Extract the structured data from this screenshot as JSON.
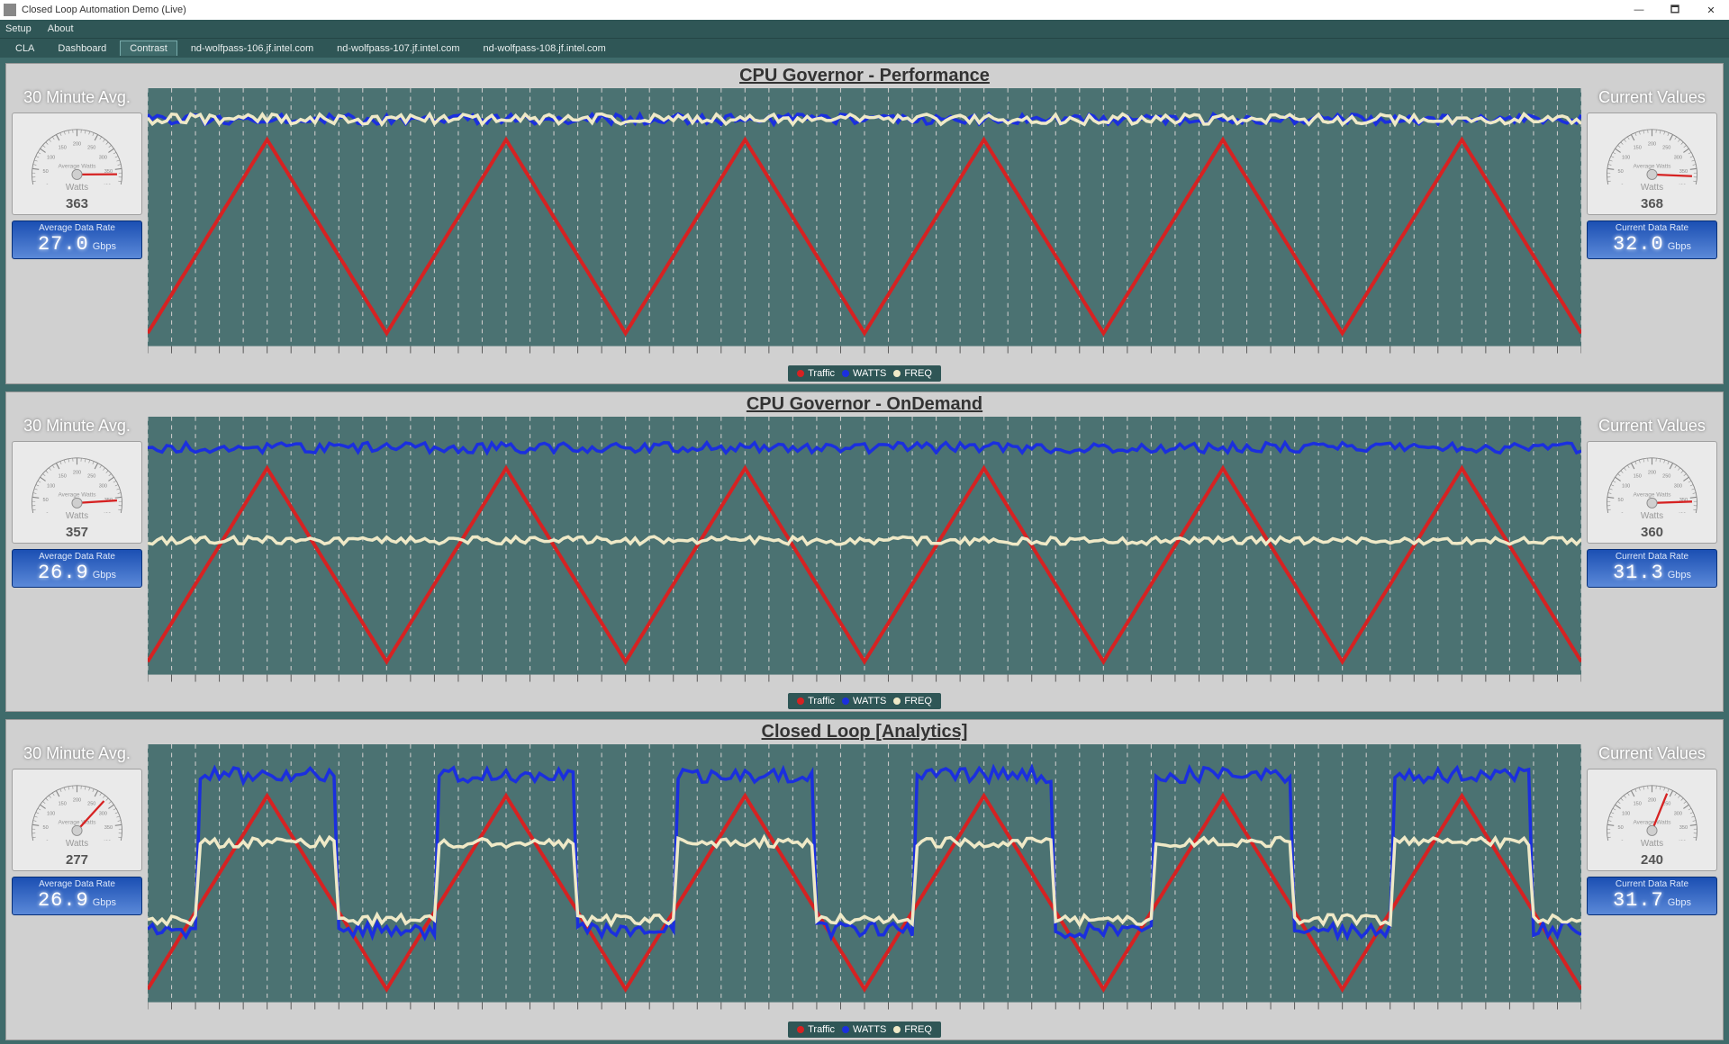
{
  "window": {
    "title": "Closed Loop Automation Demo (Live)"
  },
  "menubar": [
    "Setup",
    "About"
  ],
  "tabs": [
    "CLA",
    "Dashboard",
    "Contrast",
    "nd-wolfpass-106.jf.intel.com",
    "nd-wolfpass-107.jf.intel.com",
    "nd-wolfpass-108.jf.intel.com"
  ],
  "tabs_selected_index": 2,
  "side_headings": {
    "left": "30 Minute Avg.",
    "right": "Current Values"
  },
  "gauge": {
    "label": "Average Watts",
    "sub": "Watts",
    "ticks": [
      0,
      50,
      100,
      150,
      200,
      250,
      300,
      350,
      400
    ]
  },
  "lcd": {
    "left_label": "Average Data Rate",
    "right_label": "Current Data Rate",
    "unit": "Gbps"
  },
  "legend": [
    {
      "name": "Traffic",
      "color": "#d62222"
    },
    {
      "name": "WATTS",
      "color": "#1b2fde"
    },
    {
      "name": "FREQ",
      "color": "#efe9c7"
    }
  ],
  "colors": {
    "panel_bg": "#d0d0d0",
    "chart_bg": "#4b7272",
    "needle": "#d62222"
  },
  "panels": [
    {
      "title": "CPU Governor - Performance",
      "left": {
        "watts": 363,
        "rate": "27.0"
      },
      "right": {
        "watts": 368,
        "rate": "32.0"
      }
    },
    {
      "title": "CPU Governor - OnDemand",
      "left": {
        "watts": 357,
        "rate": "26.9"
      },
      "right": {
        "watts": 360,
        "rate": "31.3"
      }
    },
    {
      "title": "Closed Loop [Analytics]",
      "left": {
        "watts": 277,
        "rate": "26.9"
      },
      "right": {
        "watts": 240,
        "rate": "31.7"
      }
    }
  ],
  "chart_data": [
    {
      "type": "line",
      "title": "CPU Governor - Performance",
      "xlabel": "",
      "ylabel": "",
      "x_range": [
        0,
        300
      ],
      "period_seconds": 50,
      "series": [
        {
          "name": "Traffic",
          "color": "#d62222",
          "range": [
            5,
            60
          ],
          "shape": "triangle",
          "amplitude": 48,
          "baseline": 12
        },
        {
          "name": "WATTS",
          "color": "#1b2fde",
          "range": [
            360,
            380
          ],
          "shape": "noisy_flat",
          "baseline": 368,
          "jitter": 5
        },
        {
          "name": "FREQ",
          "color": "#efe9c7",
          "range": [
            0.95,
            1.0
          ],
          "shape": "noisy_flat",
          "baseline": 0.95,
          "jitter": 0.01
        }
      ]
    },
    {
      "type": "line",
      "title": "CPU Governor - OnDemand",
      "xlabel": "",
      "ylabel": "",
      "x_range": [
        0,
        300
      ],
      "period_seconds": 50,
      "series": [
        {
          "name": "Traffic",
          "color": "#d62222",
          "range": [
            5,
            60
          ],
          "shape": "triangle",
          "amplitude": 48,
          "baseline": 12
        },
        {
          "name": "WATTS",
          "color": "#1b2fde",
          "range": [
            350,
            370
          ],
          "shape": "noisy_flat",
          "baseline": 360,
          "jitter": 6
        },
        {
          "name": "FREQ",
          "color": "#efe9c7",
          "range": [
            0.55,
            0.6
          ],
          "shape": "noisy_flat",
          "baseline": 0.57,
          "jitter": 0.01
        }
      ]
    },
    {
      "type": "line",
      "title": "Closed Loop [Analytics]",
      "xlabel": "",
      "ylabel": "",
      "x_range": [
        0,
        300
      ],
      "period_seconds": 50,
      "series": [
        {
          "name": "Traffic",
          "color": "#d62222",
          "range": [
            5,
            60
          ],
          "shape": "triangle",
          "amplitude": 48,
          "baseline": 12
        },
        {
          "name": "WATTS",
          "color": "#1b2fde",
          "range": [
            190,
            300
          ],
          "shape": "square_follow",
          "low": 200,
          "high": 290,
          "jitter": 6
        },
        {
          "name": "FREQ",
          "color": "#efe9c7",
          "range": [
            0.35,
            0.75
          ],
          "shape": "step_follow",
          "low": 0.4,
          "high": 0.7,
          "jitter": 0.02
        }
      ]
    }
  ]
}
